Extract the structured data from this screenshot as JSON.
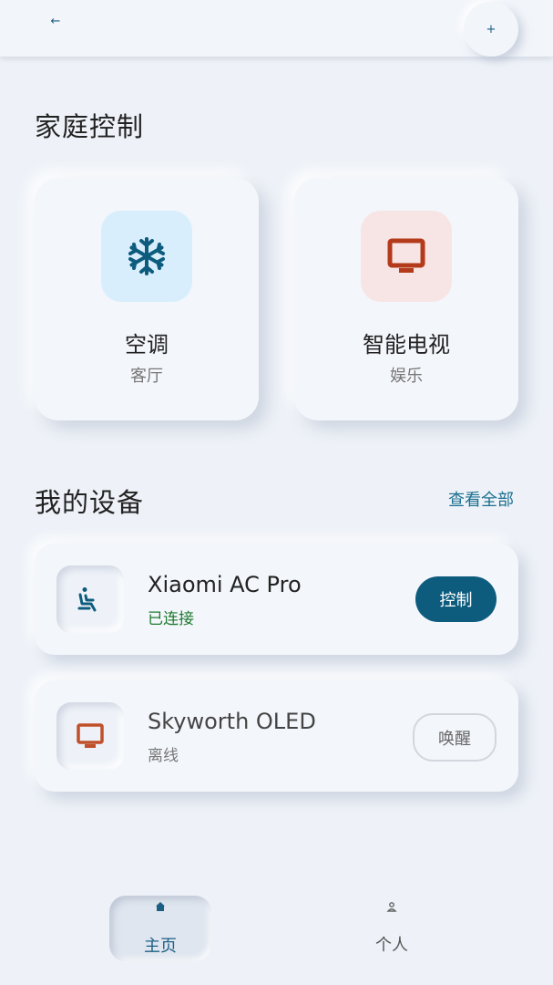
{
  "topbar": {
    "back_icon": "arrow-left-icon",
    "back_glyph": "←",
    "add_icon": "plus-icon",
    "add_glyph": "+"
  },
  "home_control": {
    "title": "家庭控制",
    "cards": [
      {
        "title": "空调",
        "subtitle": "客厅",
        "icon": "snowflake-icon",
        "icon_bg": "#d8eefc",
        "icon_color": "#0d5c7e"
      },
      {
        "title": "智能电视",
        "subtitle": "娱乐",
        "icon": "tv-icon",
        "icon_bg": "#f7e5e5",
        "icon_color": "#b33a1a"
      }
    ]
  },
  "devices": {
    "title": "我的设备",
    "view_all": "查看全部",
    "items": [
      {
        "name": "Xiaomi AC Pro",
        "status": "已连接",
        "status_color": "#1e7a2e",
        "icon": "seat-person-icon",
        "action": "控制",
        "online": true
      },
      {
        "name": "Skyworth OLED",
        "status": "离线",
        "status_color": "#777777",
        "icon": "tv-icon",
        "action": "唤醒",
        "online": false
      }
    ]
  },
  "bottom_nav": {
    "items": [
      {
        "label": "主页",
        "icon": "home-icon",
        "active": true
      },
      {
        "label": "个人",
        "icon": "person-icon",
        "active": false
      }
    ]
  },
  "colors": {
    "accent": "#0d5c7e",
    "background": "#eef2f8",
    "card": "#f3f6fb"
  }
}
